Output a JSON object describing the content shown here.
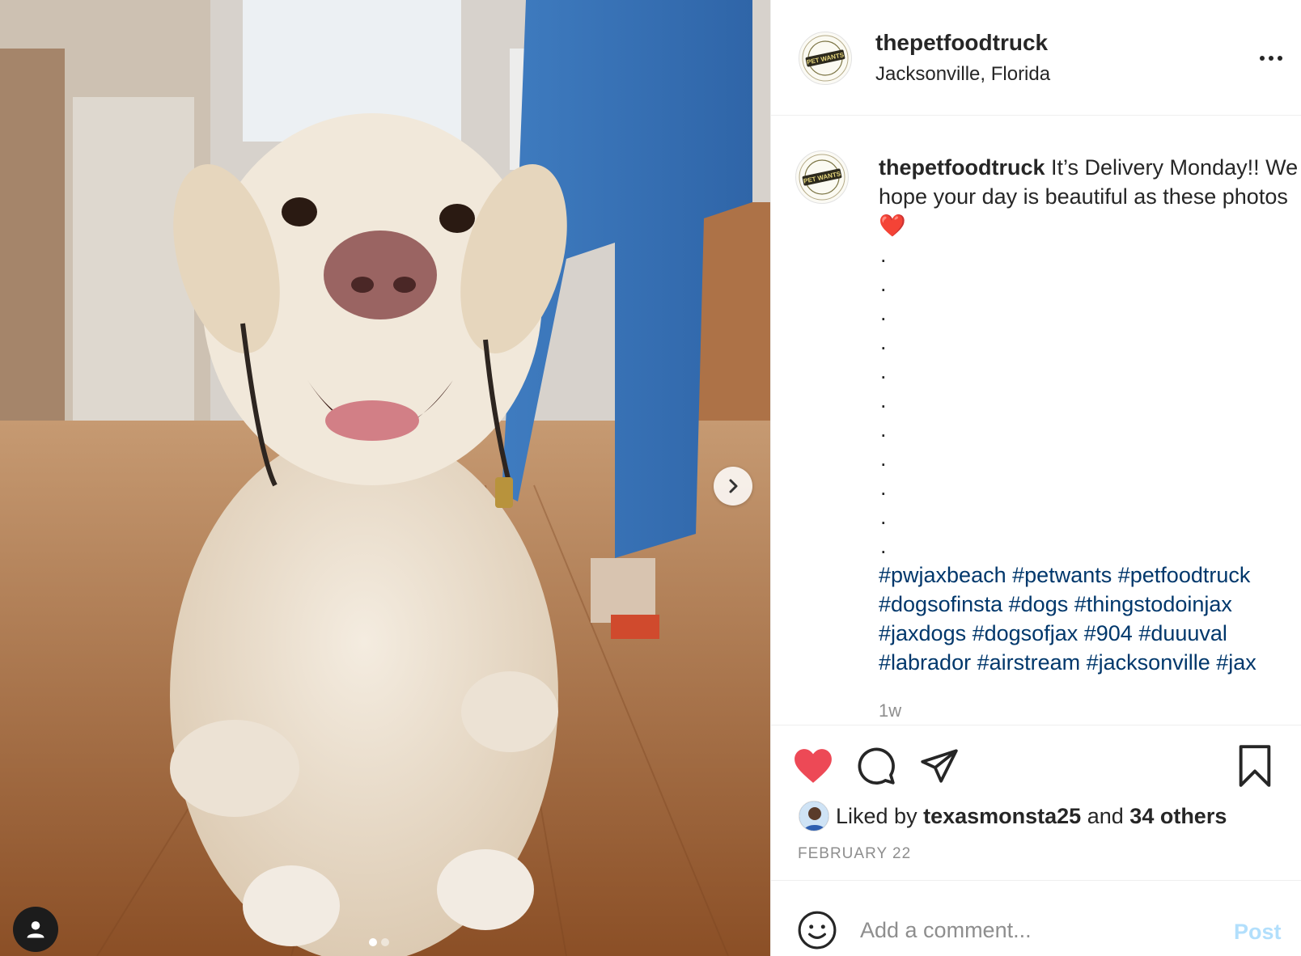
{
  "post": {
    "photo_alt": "yellow labrador photo",
    "carousel_total": 2,
    "carousel_index": 1
  },
  "header": {
    "username": "thepetfoodtruck",
    "location": "Jacksonville, Florida",
    "avatar_text": "PET WANTS",
    "more_icon": "more-horizontal-icon"
  },
  "caption": {
    "username": "thepetfoodtruck",
    "text": "It’s Delivery Monday!! We hope your day is beautiful as these photos ❤️",
    "dots": [
      ".",
      ".",
      ".",
      ".",
      ".",
      ".",
      ".",
      ".",
      ".",
      ".",
      "."
    ],
    "hashtags": [
      "#pwjaxbeach",
      "#petwants",
      "#petfoodtruck",
      "#dogsofinsta",
      "#dogs",
      "#thingstodoinjax",
      "#jaxdogs",
      "#dogsofjax",
      "#904",
      "#duuuval",
      "#labrador",
      "#airstream",
      "#jacksonville",
      "#jax"
    ],
    "time_ago": "1w"
  },
  "actions": {
    "liked": true,
    "like_color": "#ed4956",
    "liked_prefix": "Liked by",
    "liker": "texasmonsta25",
    "and": "and",
    "others": "34 others",
    "date": "FEBRUARY 22"
  },
  "comment": {
    "placeholder": "Add a comment...",
    "post_label": "Post",
    "post_color": "#b2dffc"
  }
}
